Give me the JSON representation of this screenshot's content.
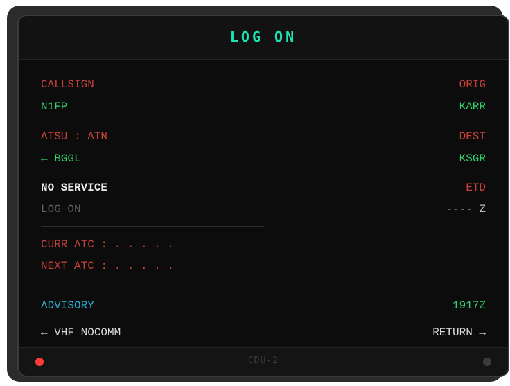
{
  "title": "LOG ON",
  "left": {
    "callsign_label": "CALLSIGN",
    "callsign_value": "N1FP",
    "atsu_label": "ATSU : ATN",
    "atsu_value": "← BGGL",
    "status": "NO SERVICE",
    "logon_action": "LOG ON",
    "curr_atc": "CURR ATC : . . . . .",
    "next_atc": "NEXT ATC : . . . . .",
    "advisory": "ADVISORY",
    "vhf": "← VHF NOCOMM"
  },
  "right": {
    "orig_label": "ORIG",
    "orig_value": "KARR",
    "dest_label": "DEST",
    "dest_value": "KSGR",
    "etd_label": "ETD",
    "etd_value": "---- Z",
    "time": "1917Z",
    "return": "RETURN →"
  },
  "footer": {
    "unit": "CDU-2"
  },
  "colors": {
    "label": "#c8423b",
    "value": "#31d36e",
    "title": "#1ee3b4",
    "advisory": "#2bb4d8",
    "inactive": "#5f5f5f",
    "led_active": "#ff3a3a"
  }
}
